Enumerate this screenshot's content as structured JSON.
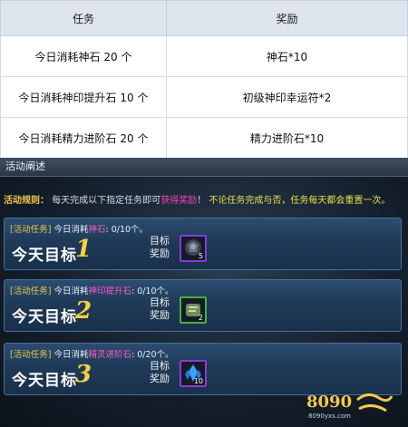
{
  "table": {
    "headers": [
      "任务",
      "奖励"
    ],
    "rows": [
      {
        "task": "今日消耗神石 20 个",
        "reward": "神石*10"
      },
      {
        "task": "今日消耗神印提升石 10 个",
        "reward": "初级神印幸运符*2"
      },
      {
        "task": "今日消耗精力进阶石 20 个",
        "reward": "精力进阶石*10"
      }
    ]
  },
  "panel": {
    "header": "活动阐述",
    "rules": {
      "label": "活动规则：",
      "part1": "每天完成以下指定任务即可",
      "part2": "获得奖励",
      "part3": "！",
      "part4": "不论任务完成与否，任务每天都会重置一次。"
    },
    "cards": [
      {
        "tag": "[活动任务]",
        "prefix": "今日消耗",
        "item": "神石",
        "progress": ": 0/10个。",
        "goal": "今天目标",
        "num": "1",
        "reward_label": "目标奖励",
        "icon": "dark-orb-icon",
        "count": "5",
        "slot_color": "purple"
      },
      {
        "tag": "[活动任务]",
        "prefix": "今日消耗",
        "item": "神印提升石",
        "progress": ": 0/10个。",
        "goal": "今天目标",
        "num": "2",
        "reward_label": "目标奖励",
        "icon": "scroll-icon",
        "count": "2",
        "slot_color": "green"
      },
      {
        "tag": "[活动任务]",
        "prefix": "今日消耗",
        "item": "精灵进阶石",
        "progress": ": 0/20个。",
        "goal": "今天目标",
        "num": "3",
        "reward_label": "目标奖励",
        "icon": "blue-crystal-icon",
        "count": "10",
        "slot_color": "purple"
      }
    ],
    "watermark": {
      "logo": "8090",
      "sub": "8090yxs.com"
    }
  }
}
